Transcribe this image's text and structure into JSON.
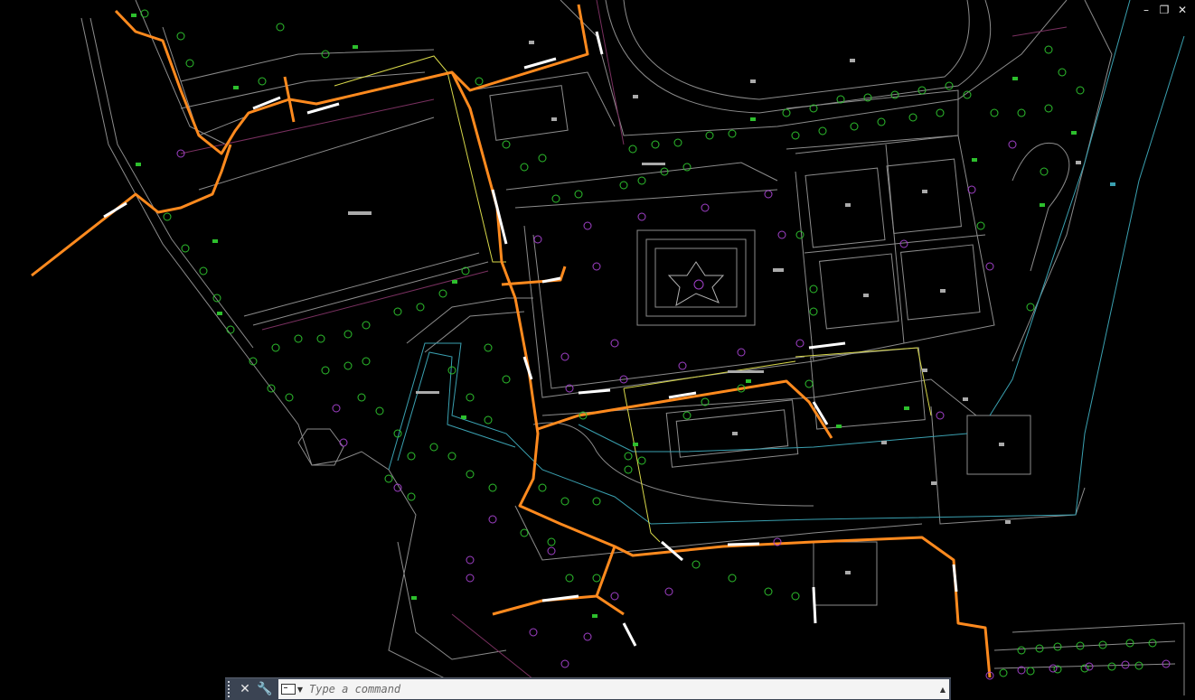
{
  "window_controls": {
    "minimize_label": "–",
    "restore_label": "❐",
    "close_label": "✕"
  },
  "command_line": {
    "close_label": "✕",
    "customize_label": "🔧",
    "placeholder": "Type a command",
    "value": ""
  },
  "colors": {
    "background": "#000000",
    "route": "#ff8a1e",
    "linework": "#9a9a9a",
    "trees": "#2dbf2d",
    "symbols": "#a040c8",
    "water": "#3aa0b0",
    "boundary": "#d8d84a",
    "cmd_bar": "#3b4453"
  }
}
